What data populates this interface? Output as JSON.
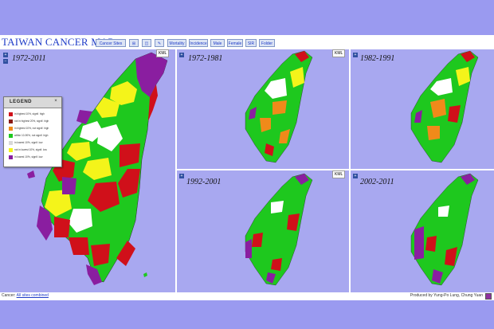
{
  "app": {
    "title": "TAIWAN CANCER MAP",
    "toolbar": [
      {
        "label": "Cancer Sites"
      },
      {
        "label": "⊞"
      },
      {
        "label": "◫"
      },
      {
        "label": "✎"
      },
      {
        "label": "Mortality"
      },
      {
        "label": "Incidence"
      },
      {
        "label": "Male"
      },
      {
        "label": "Female"
      },
      {
        "label": "SIR"
      },
      {
        "label": "Folder"
      }
    ]
  },
  "panels": [
    {
      "label": "1972-2011",
      "kml": "KML"
    },
    {
      "label": "1972-1981",
      "kml": "KML"
    },
    {
      "label": "1982-1991",
      "kml": ""
    },
    {
      "label": "1992-2001",
      "kml": "KML"
    },
    {
      "label": "2002-2011",
      "kml": ""
    }
  ],
  "legend": {
    "title": "LEGEND",
    "close": "×",
    "items": [
      {
        "color": "#d0101a",
        "text": "in highest 10%, signif. high"
      },
      {
        "color": "#8a1a14",
        "text": "not in highest 20%, signif. high"
      },
      {
        "color": "#f08a1a",
        "text": "in highest 10%, not signif. high"
      },
      {
        "color": "#1ec81e",
        "text": "within 10-90%, not signif. high"
      },
      {
        "color": "#d8d8d8",
        "text": "in lowest 10%, signif. low"
      },
      {
        "color": "#f4f41a",
        "text": "not in lowest 10%, signif. low"
      },
      {
        "color": "#8a1ea0",
        "text": "in lowest 10%, signif. low"
      }
    ]
  },
  "status": {
    "label": "Cancer",
    "link": "All sites combined",
    "credit": "Produced by Yung-Po Lung, Chung Yuan"
  },
  "colors": {
    "red": "#d0101a",
    "green": "#1ec81e",
    "yellow": "#f4f41a",
    "white": "#ffffff",
    "purple": "#8a1ea0",
    "orange": "#f08a1a"
  }
}
